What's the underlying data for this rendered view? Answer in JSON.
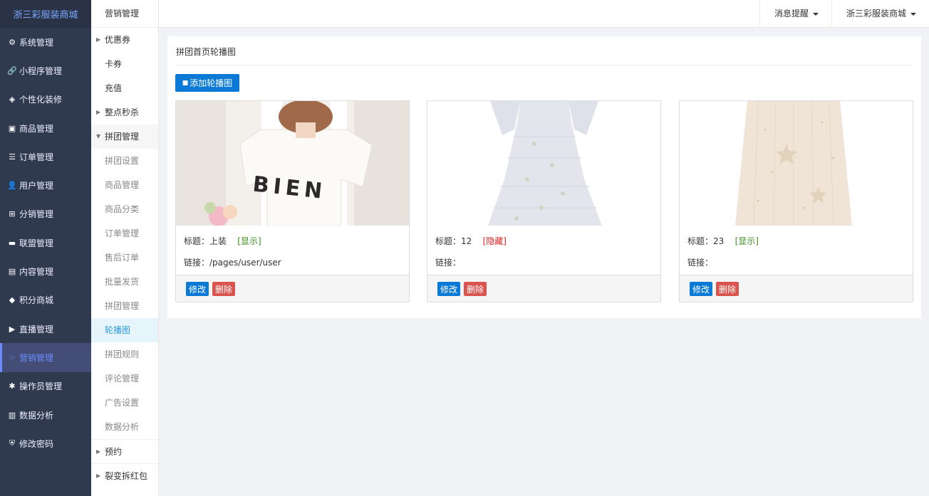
{
  "app": {
    "brand": "浙三彩服装商城"
  },
  "sidebar": {
    "items": [
      {
        "label": "系统管理",
        "icon": "gear-icon",
        "glyph": "⚙"
      },
      {
        "label": "小程序管理",
        "icon": "link-icon",
        "glyph": "🔗"
      },
      {
        "label": "个性化装修",
        "icon": "diamond-icon",
        "glyph": "◈"
      },
      {
        "label": "商品管理",
        "icon": "bag-icon",
        "glyph": "▣"
      },
      {
        "label": "订单管理",
        "icon": "list-icon",
        "glyph": "☰"
      },
      {
        "label": "用户管理",
        "icon": "user-icon",
        "glyph": "👤"
      },
      {
        "label": "分销管理",
        "icon": "network-icon",
        "glyph": "⊞"
      },
      {
        "label": "联盟管理",
        "icon": "store-icon",
        "glyph": "▬"
      },
      {
        "label": "内容管理",
        "icon": "content-icon",
        "glyph": "▤"
      },
      {
        "label": "积分商城",
        "icon": "cube-icon",
        "glyph": "◆"
      },
      {
        "label": "直播管理",
        "icon": "play-icon",
        "glyph": "▶"
      },
      {
        "label": "营销管理",
        "icon": "marketing-icon",
        "glyph": "☞"
      },
      {
        "label": "操作员管理",
        "icon": "cog-icon",
        "glyph": "✱"
      },
      {
        "label": "数据分析",
        "icon": "chart-icon",
        "glyph": "▥"
      },
      {
        "label": "修改密码",
        "icon": "shield-icon",
        "glyph": "⛨"
      }
    ]
  },
  "subnav": {
    "title": "营销管理",
    "items": [
      {
        "label": "优惠券"
      },
      {
        "label": "卡券"
      },
      {
        "label": "充值"
      },
      {
        "label": "整点秒杀"
      },
      {
        "label": "拼团管理"
      },
      {
        "label": "拼团设置"
      },
      {
        "label": "商品管理"
      },
      {
        "label": "商品分类"
      },
      {
        "label": "订单管理"
      },
      {
        "label": "售后订单"
      },
      {
        "label": "批量发货"
      },
      {
        "label": "拼团管理"
      },
      {
        "label": "轮播图"
      },
      {
        "label": "拼团规则"
      },
      {
        "label": "评论管理"
      },
      {
        "label": "广告设置"
      },
      {
        "label": "数据分析"
      },
      {
        "label": "预约"
      },
      {
        "label": "裂变拆红包"
      }
    ]
  },
  "topbar": {
    "messages": "消息提醒",
    "store": "浙三彩服装商城"
  },
  "panel": {
    "title": "拼团首页轮播图",
    "add_button": "添加轮播图",
    "title_prefix": "标题：",
    "link_prefix": "链接：",
    "edit_label": "修改",
    "delete_label": "删除",
    "cards": [
      {
        "title": "上装",
        "status": "[显示]",
        "link": "/pages/user/user",
        "image_text": "BIEN"
      },
      {
        "title": "12",
        "status": "[隐藏]",
        "link": ""
      },
      {
        "title": "23",
        "status": "[显示]",
        "link": ""
      }
    ]
  },
  "colors": {
    "sidebar_bg": "#2f3a4f",
    "accent_blue": "#0a7ad6",
    "delete_red": "#d9534f",
    "status_show": "#3a8a1c",
    "status_hide": "#e02020",
    "active_nav": "#6b8bff"
  }
}
